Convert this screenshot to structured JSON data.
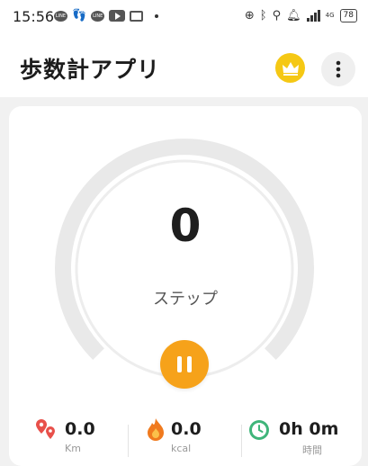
{
  "status_bar": {
    "time": "15:56",
    "network": "4G",
    "battery": "78"
  },
  "app_bar": {
    "title": "歩数計アプリ",
    "crown_icon": "crown-icon",
    "more_icon": "more-vert-icon"
  },
  "counter": {
    "steps": "0",
    "label": "ステップ",
    "progress": 0,
    "action_icon": "pause-icon"
  },
  "stats": [
    {
      "icon": "location-route-icon",
      "value": "0.0",
      "label": "Km"
    },
    {
      "icon": "flame-icon",
      "value": "0.0",
      "label": "kcal"
    },
    {
      "icon": "clock-icon",
      "value": "0h 0m",
      "label": "時間"
    }
  ],
  "colors": {
    "accent": "#f6a21a",
    "crown": "#f5c814",
    "ring": "#e9e9e9",
    "background": "#f1f1f1"
  }
}
